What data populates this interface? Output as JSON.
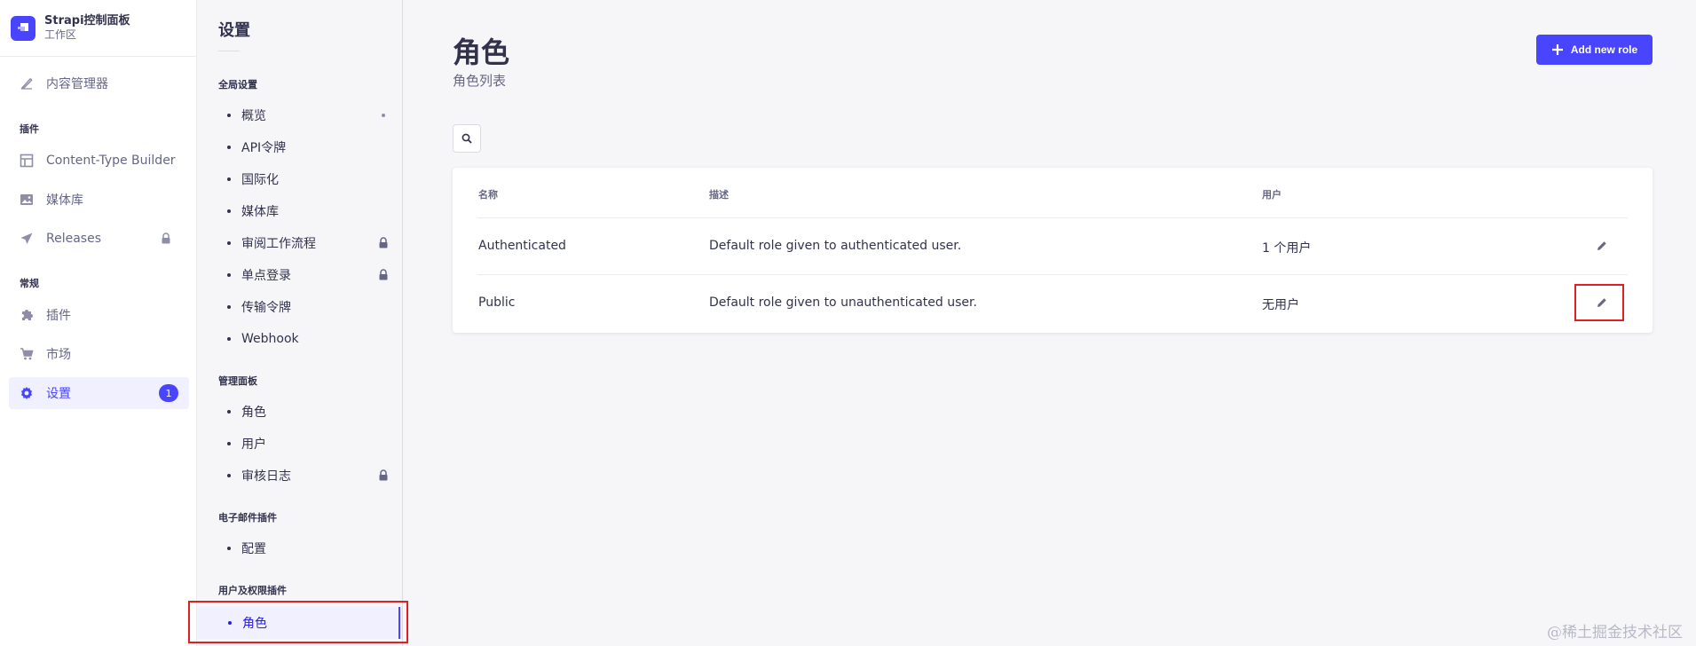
{
  "brand": {
    "title": "Strapi控制面板",
    "subtitle": "工作区",
    "color": "#4945ff"
  },
  "mainnav": {
    "content_manager": "内容管理器",
    "plugins_section": "插件",
    "content_type_builder": "Content-Type Builder",
    "media_library": "媒体库",
    "releases": "Releases",
    "general_section": "常规",
    "plugins": "插件",
    "marketplace": "市场",
    "settings": "设置",
    "settings_badge": "1"
  },
  "subnav": {
    "title": "设置",
    "global_section": "全局设置",
    "global_items": [
      "概览",
      "API令牌",
      "国际化",
      "媒体库",
      "审阅工作流程",
      "单点登录",
      "传输令牌",
      "Webhook"
    ],
    "admin_section": "管理面板",
    "admin_items": [
      "角色",
      "用户",
      "审核日志"
    ],
    "email_section": "电子邮件插件",
    "email_items": [
      "配置"
    ],
    "users_section": "用户及权限插件",
    "users_items": [
      "角色"
    ]
  },
  "main": {
    "title": "角色",
    "subtitle": "角色列表",
    "add_button": "Add new role",
    "table": {
      "headers": [
        "名称",
        "描述",
        "用户"
      ],
      "rows": [
        {
          "name": "Authenticated",
          "description": "Default role given to authenticated user.",
          "users": "1 个用户"
        },
        {
          "name": "Public",
          "description": "Default role given to unauthenticated user.",
          "users": "无用户"
        }
      ]
    }
  },
  "watermark": "@稀土掘金技术社区"
}
